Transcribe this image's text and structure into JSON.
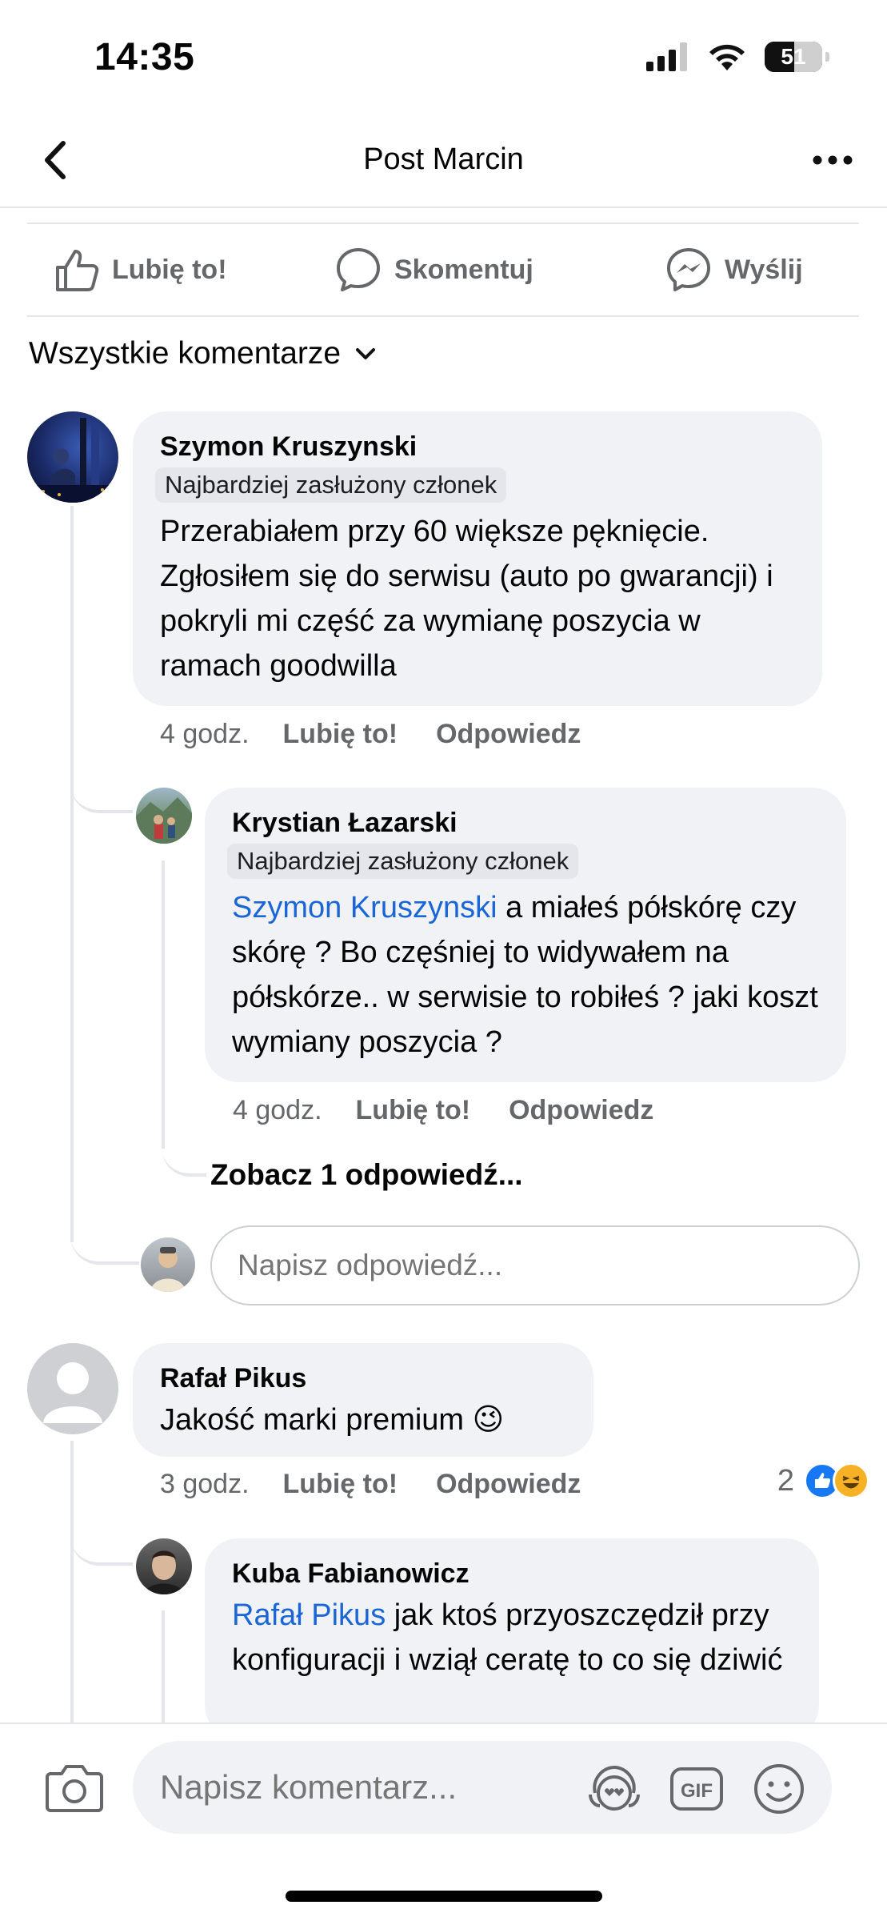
{
  "status_bar": {
    "time": "14:35",
    "battery": "51"
  },
  "header": {
    "title": "Post Marcin"
  },
  "actions": {
    "like": "Lubię to!",
    "comment": "Skomentuj",
    "send": "Wyślij"
  },
  "sort": {
    "label": "Wszystkie komentarze"
  },
  "comments": [
    {
      "author": "Szymon Kruszynski",
      "badge": "Najbardziej zasłużony członek",
      "text": "Przerabiałem przy 60 większe pęknięcie. Zgłosiłem się do serwisu (auto po gwarancji) i pokryli mi część za wymianę poszycia w ramach goodwilla",
      "time": "4 godz.",
      "like": "Lubię to!",
      "reply": "Odpowiedz",
      "replies": [
        {
          "author": "Krystian Łazarski",
          "badge": "Najbardziej zasłużony członek",
          "mention": "Szymon Kruszynski",
          "text": " a miałeś półskórę czy skórę ? Bo częśniej to widywałem na półskórze.. w serwisie to robiłeś ? jaki koszt wymiany poszycia ?",
          "time": "4 godz.",
          "like": "Lubię to!",
          "reply": "Odpowiedz"
        }
      ],
      "see_more": "Zobacz 1 odpowiedź...",
      "reply_placeholder": "Napisz odpowiedź..."
    },
    {
      "author": "Rafał Pikus",
      "text": "Jakość marki premium 😉",
      "time": "3 godz.",
      "like": "Lubię to!",
      "reply": "Odpowiedz",
      "reaction_count": "2",
      "replies": [
        {
          "author": "Kuba Fabianowicz",
          "mention": "Rafał Pikus",
          "text": " jak ktoś przyoszczędził przy konfiguracji i wziął ceratę to co się dziwić"
        }
      ]
    }
  ],
  "composer": {
    "placeholder": "Napisz komentarz...",
    "gif_label": "GIF"
  },
  "colors": {
    "link": "#1b66d6",
    "bubble": "#f0f2f5",
    "muted": "#65676b",
    "like_blue": "#1877f2"
  }
}
